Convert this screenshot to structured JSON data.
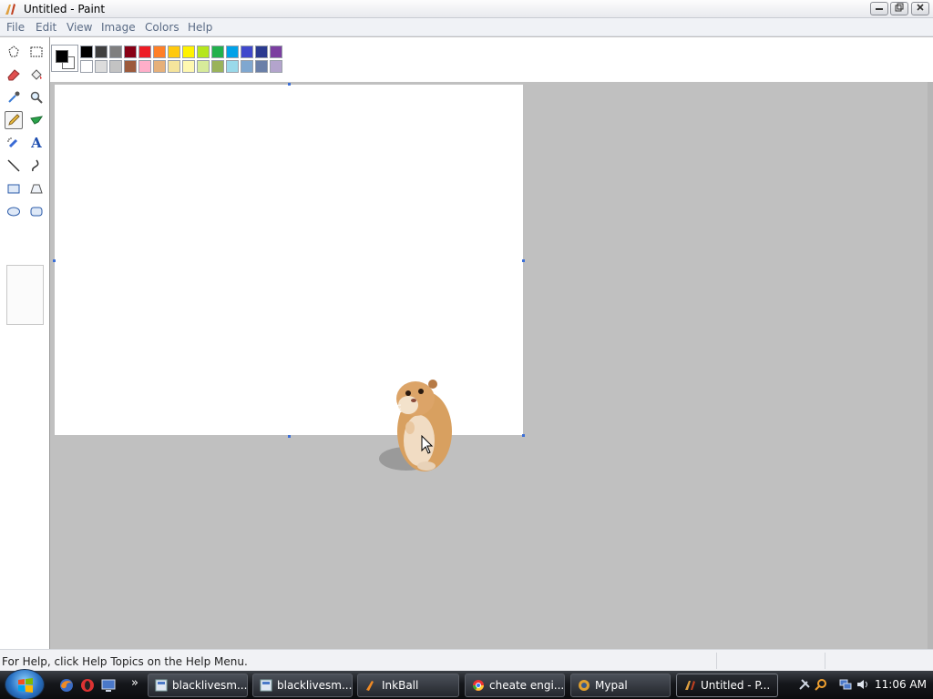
{
  "window": {
    "title": "Untitled - Paint",
    "icon": "paint-icon",
    "controls": [
      "minimize-icon",
      "restore-icon",
      "close-icon"
    ]
  },
  "menu": {
    "items": [
      "File",
      "Edit",
      "View",
      "Image",
      "Colors",
      "Help"
    ]
  },
  "tools": [
    {
      "name": "free-form-select",
      "icon": "free-form-select-icon"
    },
    {
      "name": "select",
      "icon": "rectangle-select-icon"
    },
    {
      "name": "eraser",
      "icon": "eraser-icon"
    },
    {
      "name": "fill",
      "icon": "paint-bucket-icon"
    },
    {
      "name": "pick-color",
      "icon": "eyedropper-icon"
    },
    {
      "name": "magnifier",
      "icon": "magnifier-icon"
    },
    {
      "name": "pencil",
      "icon": "pencil-icon",
      "selected": true
    },
    {
      "name": "brush",
      "icon": "brush-icon"
    },
    {
      "name": "airbrush",
      "icon": "airbrush-icon"
    },
    {
      "name": "text",
      "icon": "text-icon",
      "glyph": "A"
    },
    {
      "name": "line",
      "icon": "line-icon"
    },
    {
      "name": "curve",
      "icon": "curve-icon"
    },
    {
      "name": "rectangle",
      "icon": "rectangle-icon"
    },
    {
      "name": "polygon",
      "icon": "polygon-icon"
    },
    {
      "name": "ellipse",
      "icon": "ellipse-icon"
    },
    {
      "name": "rounded-rectangle",
      "icon": "rounded-rectangle-icon"
    }
  ],
  "colors": {
    "foreground": "#000000",
    "background": "#ffffff",
    "palette_row1": [
      "#000000",
      "#404040",
      "#7f7f7f",
      "#880015",
      "#ed1c24",
      "#ff7f27",
      "#ffc90e",
      "#fff200",
      "#b5e61d",
      "#22b14c",
      "#00a2e8",
      "#3f48cc",
      "#2b3a8f",
      "#7b3fa0"
    ],
    "palette_row2": [
      "#ffffff",
      "#dcdcdc",
      "#c3c3c3",
      "#9c5a3c",
      "#ffaec9",
      "#e6b07a",
      "#f5e49c",
      "#fff8b0",
      "#d7eb9a",
      "#9ab35a",
      "#99d9ea",
      "#7fa7d0",
      "#6a7fa8",
      "#b3a4cc"
    ]
  },
  "canvas": {
    "background": "#ffffff",
    "sticker": "hamster-image"
  },
  "status": {
    "text": "For Help, click Help Topics on the Help Menu."
  },
  "taskbar": {
    "start": "windows-start-icon",
    "quick_launch": [
      "firefox-icon",
      "opera-icon",
      "show-desktop-icon"
    ],
    "overflow": "»",
    "buttons": [
      {
        "label": "blacklivesm...",
        "icon": "webpage-icon"
      },
      {
        "label": "blacklivesm...",
        "icon": "webpage-icon"
      },
      {
        "label": "InkBall",
        "icon": "inkball-icon"
      },
      {
        "label": "cheate engi...",
        "icon": "chrome-icon"
      },
      {
        "label": "Mypal",
        "icon": "mypal-icon"
      },
      {
        "label": "Untitled - P...",
        "icon": "paint-icon",
        "active": true
      }
    ],
    "tray_icons": [
      "tools-icon",
      "search-icon",
      "network-icon",
      "volume-icon"
    ],
    "clock": "11:06 AM"
  }
}
